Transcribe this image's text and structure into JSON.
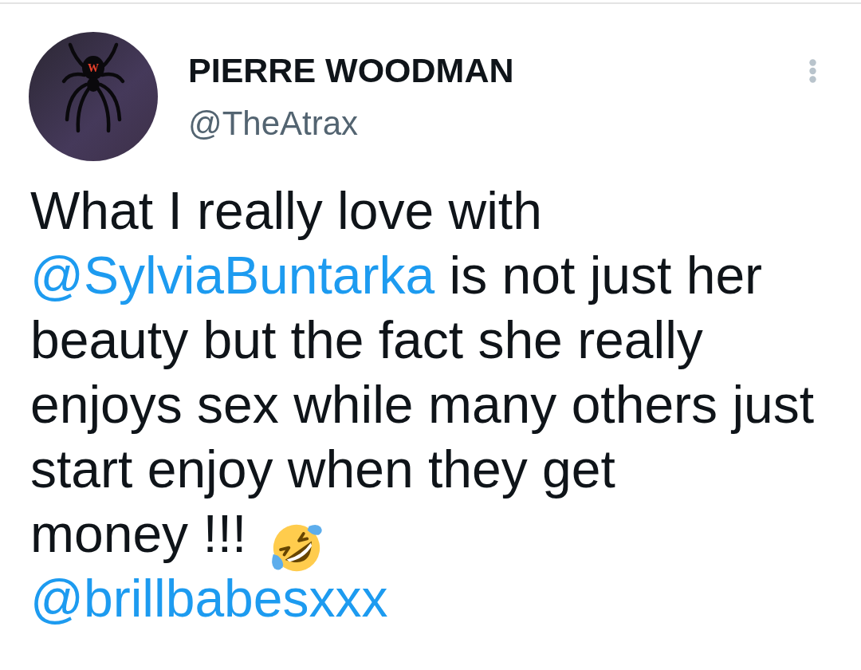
{
  "header": {
    "avatar": {
      "logo_letter": "W"
    },
    "display_name": "PIERRE WOODMAN",
    "handle": "@TheAtrax"
  },
  "tweet": {
    "blocks": [
      {
        "segments": [
          {
            "kind": "text",
            "text": "What I really love with "
          },
          {
            "kind": "mention",
            "text": "@SylviaBuntarka"
          },
          {
            "kind": "text",
            "text": " is not just her beauty but the fact she really enjoys sex while many others just start enjoy when they get"
          }
        ]
      },
      {
        "segments": [
          {
            "kind": "text",
            "text": "money !!!"
          },
          {
            "kind": "emoji"
          }
        ]
      },
      {
        "segments": [
          {
            "kind": "mention",
            "text": "@brillbabesxxx"
          }
        ]
      }
    ]
  }
}
